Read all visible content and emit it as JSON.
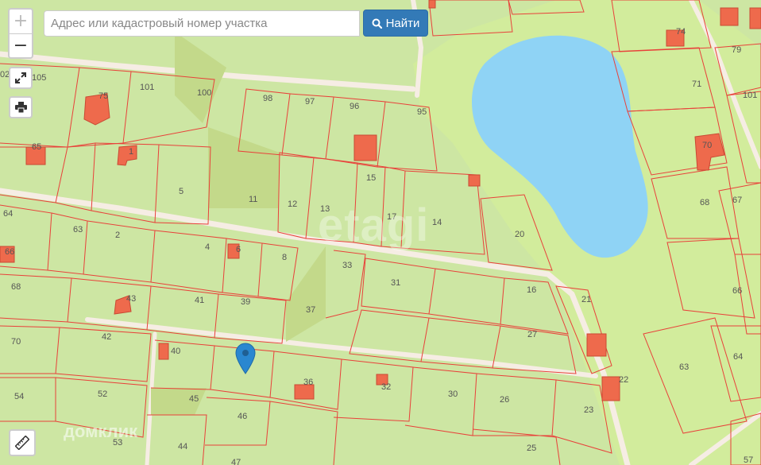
{
  "search": {
    "placeholder": "Адрес или кадастровый номер участка"
  },
  "find_button": {
    "label": "Найти",
    "icon": "search-icon"
  },
  "zoom": {
    "plus": "+",
    "minus": "−"
  },
  "watermarks": {
    "site": "etagi",
    "provider": "домклик"
  },
  "colors": {
    "parcel": "#cde6a3",
    "boundary": "#e8413a",
    "building": "#ee6a4c",
    "lake": "#8fd3f5",
    "forest": "#cfe99a",
    "road": "#f6ede4",
    "accent": "#337ab7"
  },
  "parcels": [
    "105",
    "75",
    "101",
    "100",
    "98",
    "97",
    "96",
    "95",
    "65",
    "1",
    "5",
    "11",
    "12",
    "13",
    "15",
    "17",
    "14",
    "64",
    "63",
    "2",
    "4",
    "6",
    "8",
    "33",
    "31",
    "20",
    "16",
    "66",
    "68",
    "43",
    "41",
    "39",
    "37",
    "21",
    "70",
    "42",
    "27",
    "40",
    "54",
    "52",
    "45",
    "46",
    "36",
    "32",
    "30",
    "26",
    "23",
    "22",
    "53",
    "44",
    "47",
    "25",
    "57",
    "74",
    "79",
    "71",
    "101",
    "70",
    "68",
    "67",
    "66",
    "63",
    "64",
    "02"
  ]
}
